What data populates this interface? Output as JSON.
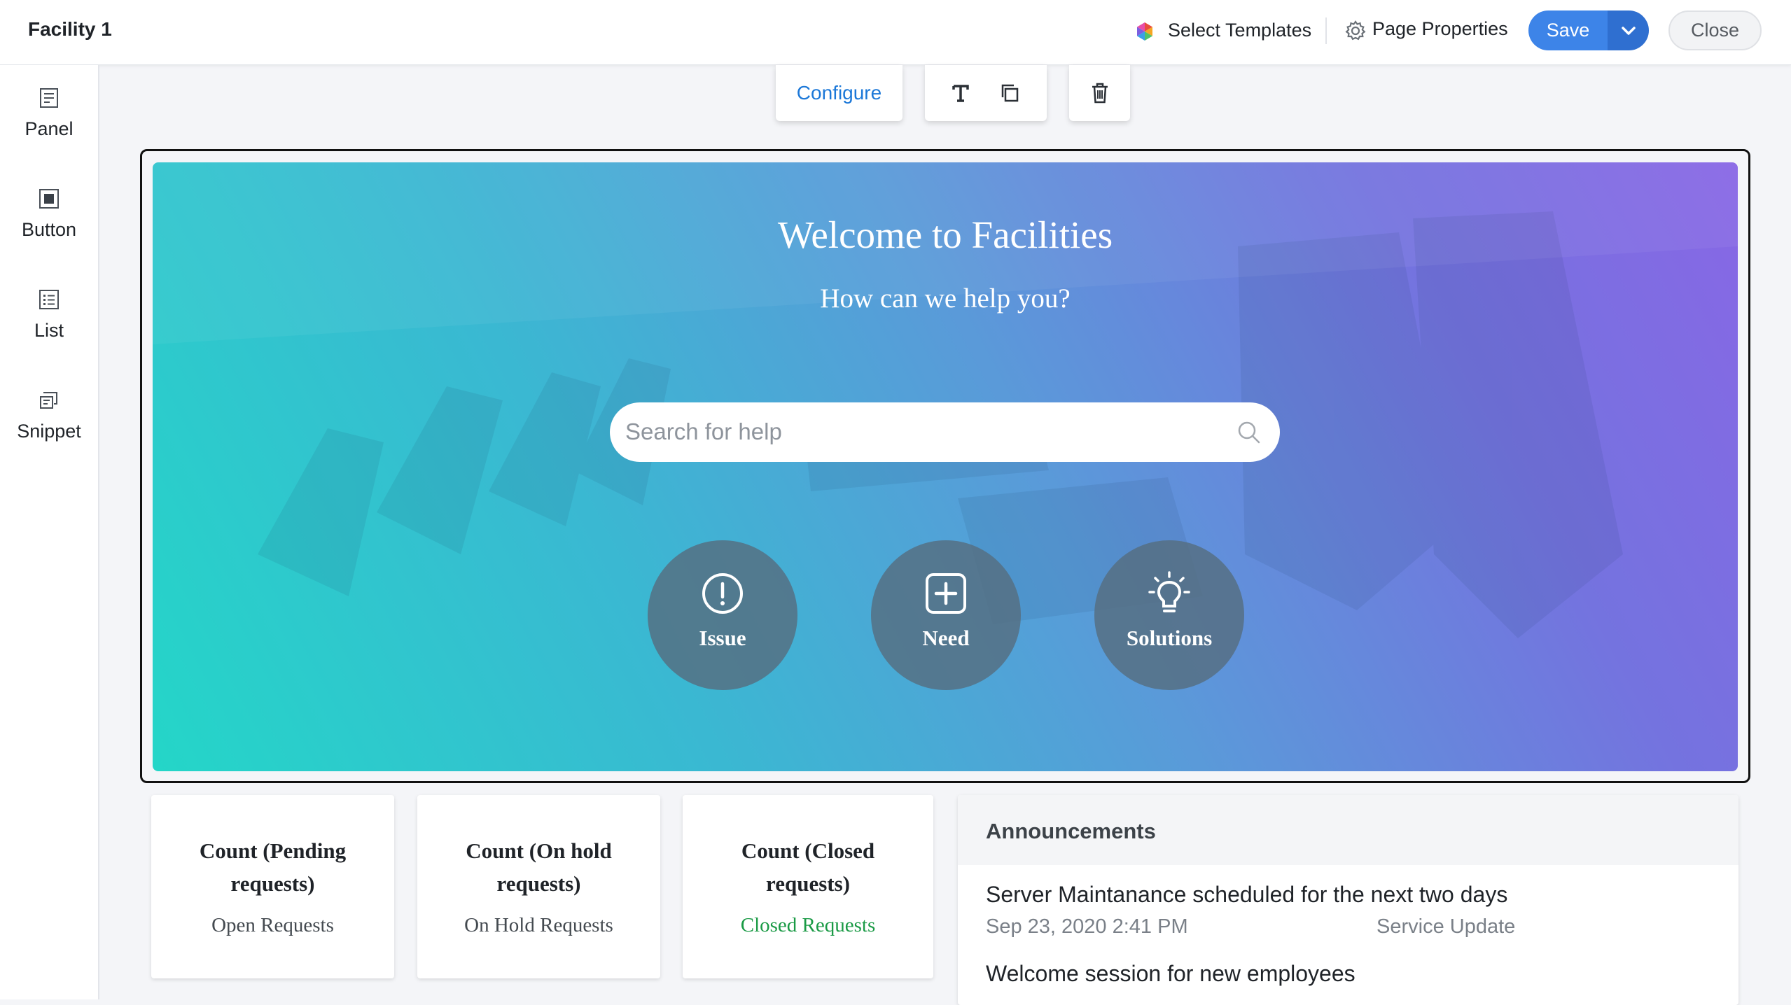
{
  "app": {
    "title": "Facility 1"
  },
  "header": {
    "select_templates": "Select Templates",
    "page_properties": "Page Properties",
    "save": "Save",
    "close": "Close"
  },
  "sidebar": {
    "items": [
      {
        "label": "Panel",
        "icon": "panel-icon"
      },
      {
        "label": "Button",
        "icon": "button-icon"
      },
      {
        "label": "List",
        "icon": "list-icon"
      },
      {
        "label": "Snippet",
        "icon": "snippet-icon"
      }
    ]
  },
  "toolbar": {
    "configure": "Configure",
    "tools": [
      "text-icon",
      "copy-icon",
      "trash-icon"
    ]
  },
  "hero": {
    "title": "Welcome to Facilities",
    "subtitle": "How can we help you?",
    "search_placeholder": "Search for help",
    "actions": [
      {
        "label": "Issue",
        "icon": "exclamation-circle-icon"
      },
      {
        "label": "Need",
        "icon": "plus-square-icon"
      },
      {
        "label": "Solutions",
        "icon": "lightbulb-icon"
      }
    ]
  },
  "cards": [
    {
      "title": "Count (Pending requests)",
      "subtitle": "Open Requests",
      "subtitle_color": "#444a50"
    },
    {
      "title": "Count (On hold requests)",
      "subtitle": "On Hold Requests",
      "subtitle_color": "#444a50"
    },
    {
      "title": "Count (Closed requests)",
      "subtitle": "Closed Requests",
      "subtitle_color": "#1a9a45"
    }
  ],
  "announcements": {
    "title": "Announcements",
    "items": [
      {
        "title": "Server Maintanance scheduled for the next two days",
        "date": "Sep 23, 2020 2:41 PM",
        "category": "Service Update"
      },
      {
        "title": "Welcome session for new employees"
      }
    ]
  },
  "colors": {
    "accent": "#3d84e8",
    "configure_link": "#1c78d8",
    "hero_gradient_start": "#24d6c8",
    "hero_gradient_end": "#8867e5"
  }
}
